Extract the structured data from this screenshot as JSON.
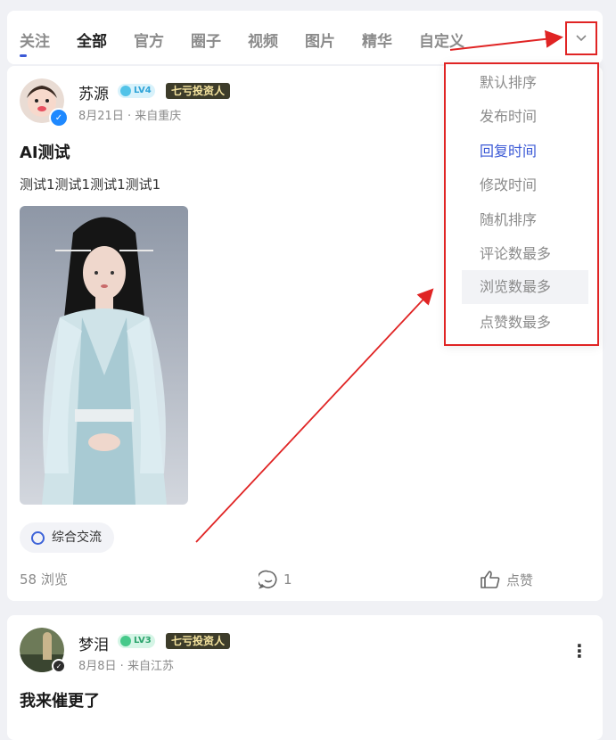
{
  "tabs": [
    {
      "label": "关注"
    },
    {
      "label": "全部"
    },
    {
      "label": "官方"
    },
    {
      "label": "圈子"
    },
    {
      "label": "视频"
    },
    {
      "label": "图片"
    },
    {
      "label": "精华"
    },
    {
      "label": "自定义"
    }
  ],
  "sort_menu": {
    "items": [
      {
        "label": "默认排序"
      },
      {
        "label": "发布时间"
      },
      {
        "label": "回复时间"
      },
      {
        "label": "修改时间"
      },
      {
        "label": "随机排序"
      },
      {
        "label": "评论数最多"
      },
      {
        "label": "浏览数最多"
      },
      {
        "label": "点赞数最多"
      }
    ],
    "active_label": "回复时间",
    "toggle_icon": "chevron-down-icon"
  },
  "posts": [
    {
      "author": "苏源",
      "level": "LV4",
      "rank": "七亏投资人",
      "meta": "8月21日 · 来自重庆",
      "title": "AI测试",
      "body": "测试1测试1测试1测试1",
      "topic": "综合交流",
      "views": "58 浏览",
      "comments": "1",
      "like_label": "点赞"
    },
    {
      "author": "梦泪",
      "level": "LV3",
      "rank": "七亏投资人",
      "meta": "8月8日 · 来自江苏",
      "title": "我来催更了"
    }
  ],
  "colors": {
    "accent": "#3b59d6",
    "annotation": "#e02424",
    "badge_dark": "#3d3c2a"
  }
}
